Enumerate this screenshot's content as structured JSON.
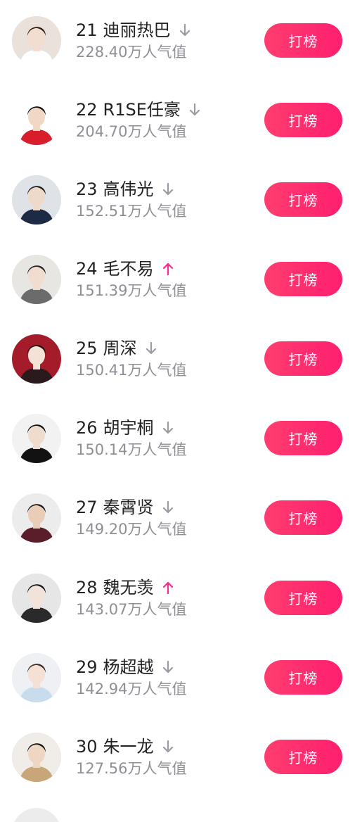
{
  "button_label": "打榜",
  "colors": {
    "accent": "#ff2a6f",
    "up": "#ff2a8a",
    "down": "#9b9ba3",
    "text": "#222222",
    "subtext": "#8f8f96"
  },
  "rows": [
    {
      "rank": "21",
      "name": "迪丽热巴",
      "score": "228.40万人气值",
      "trend": "down",
      "avatar_bg": "#e9e1da",
      "face": "#f3ddd0",
      "hair": "#2a1e18",
      "cloth": "#ffffff"
    },
    {
      "rank": "22",
      "name": "R1SE任豪",
      "score": "204.70万人气值",
      "trend": "down",
      "avatar_bg": "#ffffff",
      "face": "#f0d8c4",
      "hair": "#111111",
      "cloth": "#d81e2a"
    },
    {
      "rank": "23",
      "name": "高伟光",
      "score": "152.51万人气值",
      "trend": "down",
      "avatar_bg": "#dfe3e7",
      "face": "#efd9c8",
      "hair": "#1c1c1c",
      "cloth": "#1d2a44"
    },
    {
      "rank": "24",
      "name": "毛不易",
      "score": "151.39万人气值",
      "trend": "up",
      "avatar_bg": "#e8e6e2",
      "face": "#f1ddd0",
      "hair": "#222222",
      "cloth": "#6b6b6b"
    },
    {
      "rank": "25",
      "name": "周深",
      "score": "150.41万人气值",
      "trend": "down",
      "avatar_bg": "#a41c2a",
      "face": "#f5e2d7",
      "hair": "#1a1214",
      "cloth": "#2b1a1d"
    },
    {
      "rank": "26",
      "name": "胡宇桐",
      "score": "150.14万人气值",
      "trend": "down",
      "avatar_bg": "#f2f2f2",
      "face": "#f0dccd",
      "hair": "#111111",
      "cloth": "#121212"
    },
    {
      "rank": "27",
      "name": "秦霄贤",
      "score": "149.20万人气值",
      "trend": "down",
      "avatar_bg": "#ececec",
      "face": "#e9cdb9",
      "hair": "#1a1a1a",
      "cloth": "#5a1e2a"
    },
    {
      "rank": "28",
      "name": "魏无羡",
      "score": "143.07万人气值",
      "trend": "up",
      "avatar_bg": "#e6e6e6",
      "face": "#f2e3da",
      "hair": "#141414",
      "cloth": "#2a2a2a"
    },
    {
      "rank": "29",
      "name": "杨超越",
      "score": "142.94万人气值",
      "trend": "down",
      "avatar_bg": "#eef0f3",
      "face": "#f4e0d4",
      "hair": "#3a2a22",
      "cloth": "#c9dcee"
    },
    {
      "rank": "30",
      "name": "朱一龙",
      "score": "127.56万人气值",
      "trend": "down",
      "avatar_bg": "#f0ece8",
      "face": "#efd6c3",
      "hair": "#141414",
      "cloth": "#c9a57a"
    }
  ]
}
